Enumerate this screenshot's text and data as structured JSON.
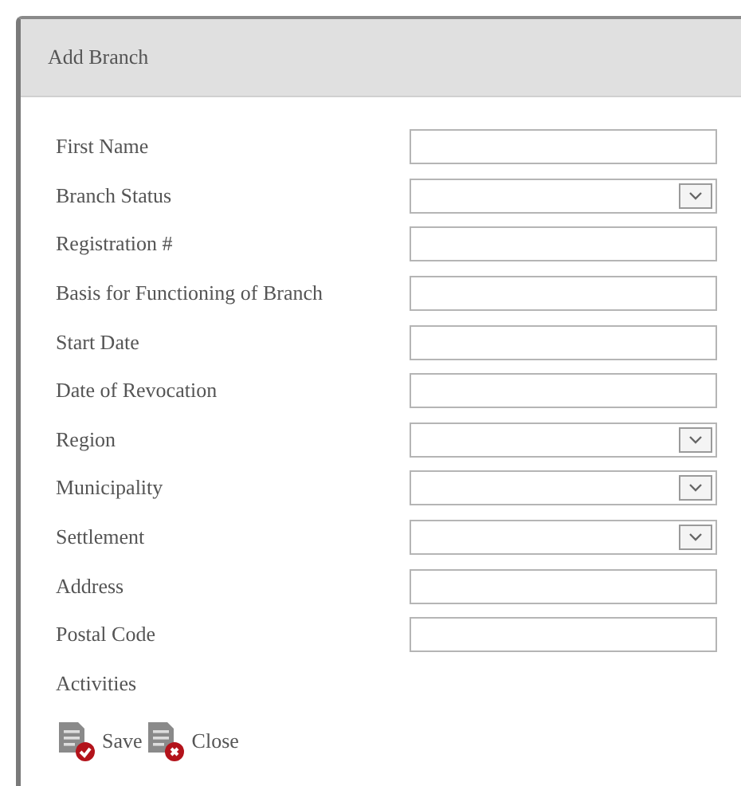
{
  "dialog": {
    "title": "Add Branch"
  },
  "fields": [
    {
      "label": "First Name",
      "kind": "text"
    },
    {
      "label": "Branch Status",
      "kind": "select"
    },
    {
      "label": "Registration #",
      "kind": "text"
    },
    {
      "label": "Basis for Functioning of Branch",
      "kind": "text"
    },
    {
      "label": "Start Date",
      "kind": "text"
    },
    {
      "label": "Date of Revocation",
      "kind": "text"
    },
    {
      "label": "Region",
      "kind": "select"
    },
    {
      "label": "Municipality",
      "kind": "select"
    },
    {
      "label": "Settlement",
      "kind": "select"
    },
    {
      "label": "Address",
      "kind": "text"
    },
    {
      "label": "Postal Code",
      "kind": "text"
    },
    {
      "label": "Activities",
      "kind": "none"
    }
  ],
  "buttons": [
    {
      "label": "Save",
      "kind": "save"
    },
    {
      "label": "Close",
      "kind": "close"
    }
  ]
}
